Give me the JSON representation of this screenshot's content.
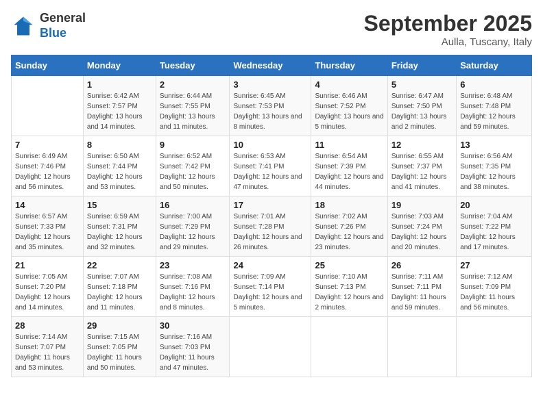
{
  "logo": {
    "text_general": "General",
    "text_blue": "Blue"
  },
  "title": "September 2025",
  "location": "Aulla, Tuscany, Italy",
  "days_of_week": [
    "Sunday",
    "Monday",
    "Tuesday",
    "Wednesday",
    "Thursday",
    "Friday",
    "Saturday"
  ],
  "weeks": [
    [
      {
        "day": "",
        "sunrise": "",
        "sunset": "",
        "daylight": ""
      },
      {
        "day": "1",
        "sunrise": "Sunrise: 6:42 AM",
        "sunset": "Sunset: 7:57 PM",
        "daylight": "Daylight: 13 hours and 14 minutes."
      },
      {
        "day": "2",
        "sunrise": "Sunrise: 6:44 AM",
        "sunset": "Sunset: 7:55 PM",
        "daylight": "Daylight: 13 hours and 11 minutes."
      },
      {
        "day": "3",
        "sunrise": "Sunrise: 6:45 AM",
        "sunset": "Sunset: 7:53 PM",
        "daylight": "Daylight: 13 hours and 8 minutes."
      },
      {
        "day": "4",
        "sunrise": "Sunrise: 6:46 AM",
        "sunset": "Sunset: 7:52 PM",
        "daylight": "Daylight: 13 hours and 5 minutes."
      },
      {
        "day": "5",
        "sunrise": "Sunrise: 6:47 AM",
        "sunset": "Sunset: 7:50 PM",
        "daylight": "Daylight: 13 hours and 2 minutes."
      },
      {
        "day": "6",
        "sunrise": "Sunrise: 6:48 AM",
        "sunset": "Sunset: 7:48 PM",
        "daylight": "Daylight: 12 hours and 59 minutes."
      }
    ],
    [
      {
        "day": "7",
        "sunrise": "Sunrise: 6:49 AM",
        "sunset": "Sunset: 7:46 PM",
        "daylight": "Daylight: 12 hours and 56 minutes."
      },
      {
        "day": "8",
        "sunrise": "Sunrise: 6:50 AM",
        "sunset": "Sunset: 7:44 PM",
        "daylight": "Daylight: 12 hours and 53 minutes."
      },
      {
        "day": "9",
        "sunrise": "Sunrise: 6:52 AM",
        "sunset": "Sunset: 7:42 PM",
        "daylight": "Daylight: 12 hours and 50 minutes."
      },
      {
        "day": "10",
        "sunrise": "Sunrise: 6:53 AM",
        "sunset": "Sunset: 7:41 PM",
        "daylight": "Daylight: 12 hours and 47 minutes."
      },
      {
        "day": "11",
        "sunrise": "Sunrise: 6:54 AM",
        "sunset": "Sunset: 7:39 PM",
        "daylight": "Daylight: 12 hours and 44 minutes."
      },
      {
        "day": "12",
        "sunrise": "Sunrise: 6:55 AM",
        "sunset": "Sunset: 7:37 PM",
        "daylight": "Daylight: 12 hours and 41 minutes."
      },
      {
        "day": "13",
        "sunrise": "Sunrise: 6:56 AM",
        "sunset": "Sunset: 7:35 PM",
        "daylight": "Daylight: 12 hours and 38 minutes."
      }
    ],
    [
      {
        "day": "14",
        "sunrise": "Sunrise: 6:57 AM",
        "sunset": "Sunset: 7:33 PM",
        "daylight": "Daylight: 12 hours and 35 minutes."
      },
      {
        "day": "15",
        "sunrise": "Sunrise: 6:59 AM",
        "sunset": "Sunset: 7:31 PM",
        "daylight": "Daylight: 12 hours and 32 minutes."
      },
      {
        "day": "16",
        "sunrise": "Sunrise: 7:00 AM",
        "sunset": "Sunset: 7:29 PM",
        "daylight": "Daylight: 12 hours and 29 minutes."
      },
      {
        "day": "17",
        "sunrise": "Sunrise: 7:01 AM",
        "sunset": "Sunset: 7:28 PM",
        "daylight": "Daylight: 12 hours and 26 minutes."
      },
      {
        "day": "18",
        "sunrise": "Sunrise: 7:02 AM",
        "sunset": "Sunset: 7:26 PM",
        "daylight": "Daylight: 12 hours and 23 minutes."
      },
      {
        "day": "19",
        "sunrise": "Sunrise: 7:03 AM",
        "sunset": "Sunset: 7:24 PM",
        "daylight": "Daylight: 12 hours and 20 minutes."
      },
      {
        "day": "20",
        "sunrise": "Sunrise: 7:04 AM",
        "sunset": "Sunset: 7:22 PM",
        "daylight": "Daylight: 12 hours and 17 minutes."
      }
    ],
    [
      {
        "day": "21",
        "sunrise": "Sunrise: 7:05 AM",
        "sunset": "Sunset: 7:20 PM",
        "daylight": "Daylight: 12 hours and 14 minutes."
      },
      {
        "day": "22",
        "sunrise": "Sunrise: 7:07 AM",
        "sunset": "Sunset: 7:18 PM",
        "daylight": "Daylight: 12 hours and 11 minutes."
      },
      {
        "day": "23",
        "sunrise": "Sunrise: 7:08 AM",
        "sunset": "Sunset: 7:16 PM",
        "daylight": "Daylight: 12 hours and 8 minutes."
      },
      {
        "day": "24",
        "sunrise": "Sunrise: 7:09 AM",
        "sunset": "Sunset: 7:14 PM",
        "daylight": "Daylight: 12 hours and 5 minutes."
      },
      {
        "day": "25",
        "sunrise": "Sunrise: 7:10 AM",
        "sunset": "Sunset: 7:13 PM",
        "daylight": "Daylight: 12 hours and 2 minutes."
      },
      {
        "day": "26",
        "sunrise": "Sunrise: 7:11 AM",
        "sunset": "Sunset: 7:11 PM",
        "daylight": "Daylight: 11 hours and 59 minutes."
      },
      {
        "day": "27",
        "sunrise": "Sunrise: 7:12 AM",
        "sunset": "Sunset: 7:09 PM",
        "daylight": "Daylight: 11 hours and 56 minutes."
      }
    ],
    [
      {
        "day": "28",
        "sunrise": "Sunrise: 7:14 AM",
        "sunset": "Sunset: 7:07 PM",
        "daylight": "Daylight: 11 hours and 53 minutes."
      },
      {
        "day": "29",
        "sunrise": "Sunrise: 7:15 AM",
        "sunset": "Sunset: 7:05 PM",
        "daylight": "Daylight: 11 hours and 50 minutes."
      },
      {
        "day": "30",
        "sunrise": "Sunrise: 7:16 AM",
        "sunset": "Sunset: 7:03 PM",
        "daylight": "Daylight: 11 hours and 47 minutes."
      },
      {
        "day": "",
        "sunrise": "",
        "sunset": "",
        "daylight": ""
      },
      {
        "day": "",
        "sunrise": "",
        "sunset": "",
        "daylight": ""
      },
      {
        "day": "",
        "sunrise": "",
        "sunset": "",
        "daylight": ""
      },
      {
        "day": "",
        "sunrise": "",
        "sunset": "",
        "daylight": ""
      }
    ]
  ]
}
